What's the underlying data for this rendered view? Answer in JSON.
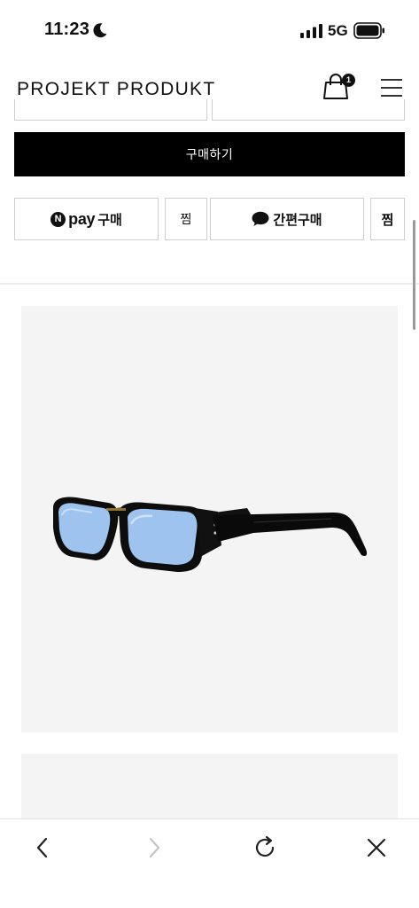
{
  "status_bar": {
    "time": "11:23",
    "network": "5G",
    "icons": [
      "moon-icon",
      "cellular-signal-icon",
      "battery-icon"
    ]
  },
  "header": {
    "logo": "PROJEKT PRODUKT",
    "cart_count": "1",
    "icons": [
      "shopping-bag-icon",
      "hamburger-menu-icon"
    ]
  },
  "actions": {
    "buy_label": "구매하기",
    "npay_badge": "N",
    "npay_word": "pay",
    "npay_label": "구매",
    "wish_label": "찜",
    "kakao_label": "간편구매",
    "wish2_label": "찜"
  },
  "colors": {
    "brand_black": "#000000",
    "image_bg": "#f4f4f4",
    "lens_blue": "#9ec3ef"
  },
  "browser_toolbar": {
    "icons": [
      "back-arrow-icon",
      "forward-arrow-icon",
      "reload-icon",
      "close-icon"
    ],
    "forward_enabled": false
  }
}
